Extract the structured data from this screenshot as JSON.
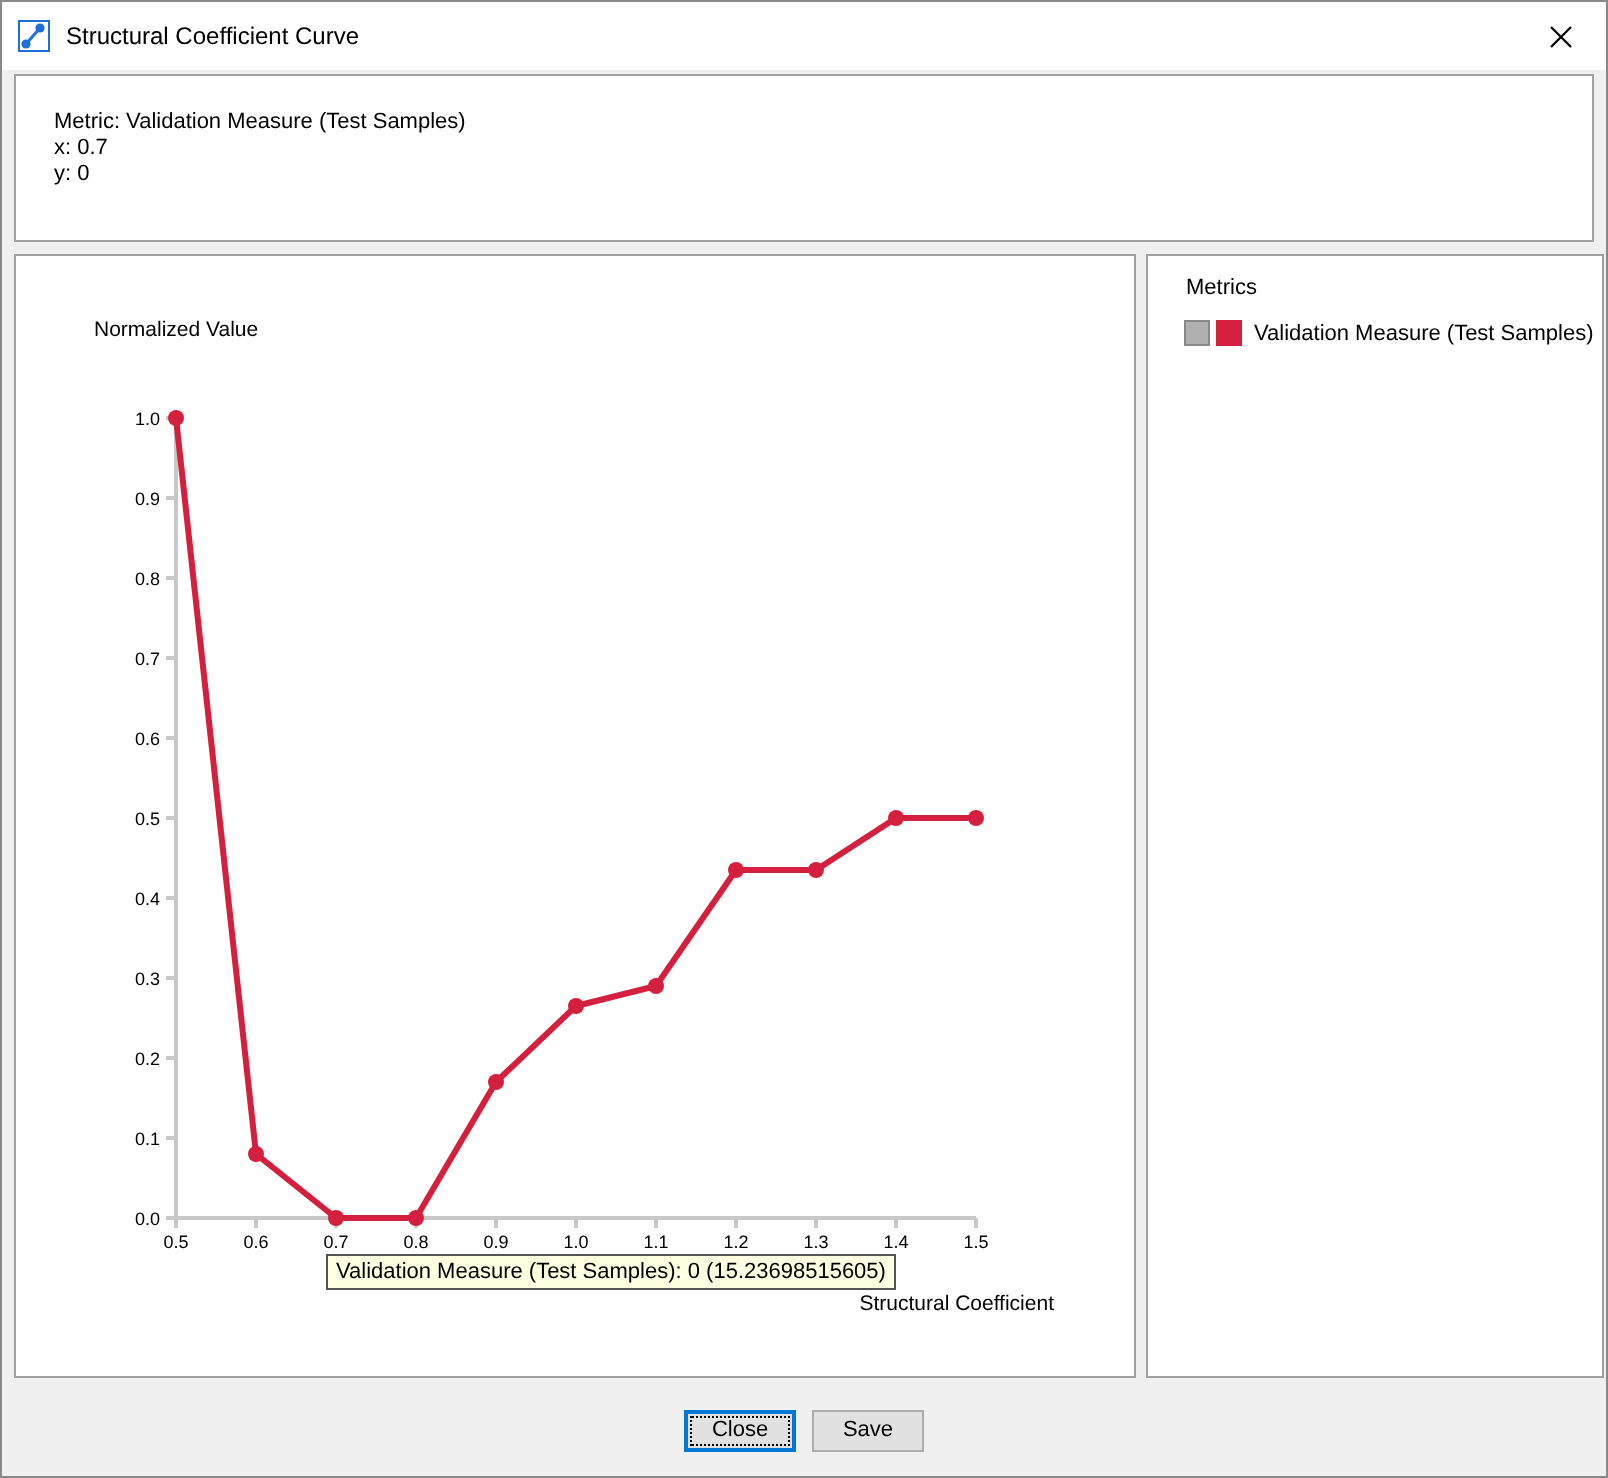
{
  "window": {
    "title": "Structural Coefficient Curve"
  },
  "info": {
    "lines": [
      "Metric: Validation Measure (Test Samples)",
      "x: 0.7",
      "y: 0"
    ]
  },
  "chart": {
    "chart_data": {
      "type": "line",
      "xlabel": "Structural Coefficient",
      "ylabel": "Normalized Value",
      "x": [
        0.5,
        0.6,
        0.7,
        0.8,
        0.9,
        1.0,
        1.1,
        1.2,
        1.3,
        1.4,
        1.5
      ],
      "series": [
        {
          "name": "Validation Measure (Test Samples)",
          "color": "#d41f3e",
          "marker": "circle",
          "values": [
            1.0,
            0.08,
            0,
            0,
            0.17,
            0.265,
            0.29,
            0.435,
            0.435,
            0.5,
            0.5
          ]
        }
      ],
      "xlim": [
        0.5,
        1.5
      ],
      "ylim": [
        0,
        1
      ],
      "xticks": [
        {
          "value": 0.5,
          "label": "0.5"
        },
        {
          "value": 0.6,
          "label": "0.6"
        },
        {
          "value": 0.7,
          "label": "0.7"
        },
        {
          "value": 0.8,
          "label": "0.8"
        },
        {
          "value": 0.9,
          "label": "0.9"
        },
        {
          "value": 1.0,
          "label": "1.0"
        },
        {
          "value": 1.1,
          "label": "1.1"
        },
        {
          "value": 1.2,
          "label": "1.2"
        },
        {
          "value": 1.3,
          "label": "1.3"
        },
        {
          "value": 1.4,
          "label": "1.4"
        },
        {
          "value": 1.5,
          "label": "1.5"
        }
      ],
      "yticks": [
        {
          "value": 0,
          "label": "0.0"
        },
        {
          "value": 0.1,
          "label": "0.1"
        },
        {
          "value": 0.2,
          "label": "0.2"
        },
        {
          "value": 0.3,
          "label": "0.3"
        },
        {
          "value": 0.4,
          "label": "0.4"
        },
        {
          "value": 0.5,
          "label": "0.5"
        },
        {
          "value": 0.6,
          "label": "0.6"
        },
        {
          "value": 0.7,
          "label": "0.7"
        },
        {
          "value": 0.8,
          "label": "0.8"
        },
        {
          "value": 0.9,
          "label": "0.9"
        },
        {
          "value": 1.0,
          "label": "1.0"
        }
      ]
    },
    "tooltip": "Validation Measure (Test Samples): 0 (15.23698515605)"
  },
  "legend": {
    "title": "Metrics"
  },
  "buttons": [
    {
      "label": "Close",
      "selected": true
    },
    {
      "label": "Save",
      "selected": false
    }
  ]
}
